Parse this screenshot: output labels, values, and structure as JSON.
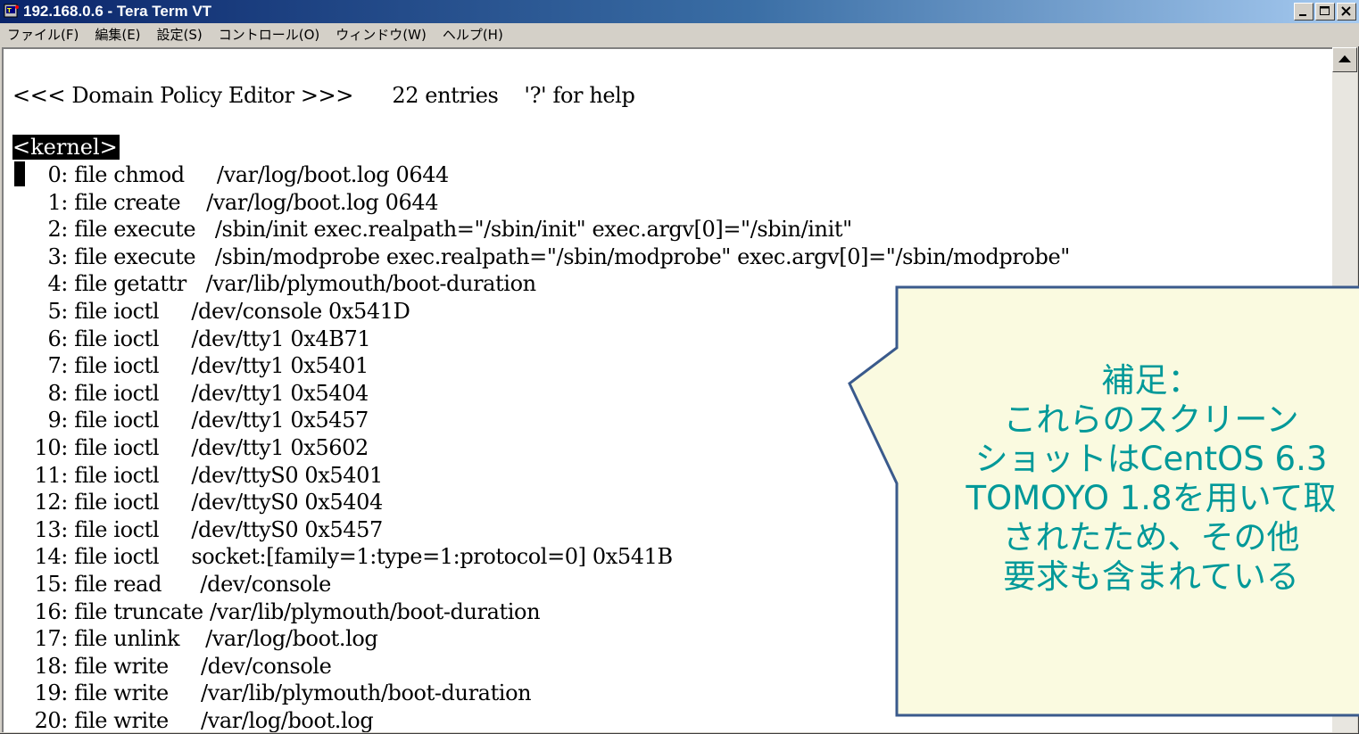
{
  "window": {
    "title": "192.168.0.6 - Tera Term VT",
    "icon": "teraterm-icon",
    "buttons": [
      "minimize",
      "maximize",
      "close"
    ]
  },
  "menubar": {
    "items": [
      "ファイル(F)",
      "編集(E)",
      "設定(S)",
      "コントロール(O)",
      "ウィンドウ(W)",
      "ヘルプ(H)"
    ]
  },
  "terminal": {
    "header": "<<< Domain Policy Editor >>>      22 entries    '?' for help",
    "domain": "<kernel>",
    "entries": [
      {
        "num": "0:",
        "text": "file chmod     /var/log/boot.log 0644"
      },
      {
        "num": "1:",
        "text": "file create    /var/log/boot.log 0644"
      },
      {
        "num": "2:",
        "text": "file execute   /sbin/init exec.realpath=\"/sbin/init\" exec.argv[0]=\"/sbin/init\""
      },
      {
        "num": "3:",
        "text": "file execute   /sbin/modprobe exec.realpath=\"/sbin/modprobe\" exec.argv[0]=\"/sbin/modprobe\""
      },
      {
        "num": "4:",
        "text": "file getattr   /var/lib/plymouth/boot-duration"
      },
      {
        "num": "5:",
        "text": "file ioctl     /dev/console 0x541D"
      },
      {
        "num": "6:",
        "text": "file ioctl     /dev/tty1 0x4B71"
      },
      {
        "num": "7:",
        "text": "file ioctl     /dev/tty1 0x5401"
      },
      {
        "num": "8:",
        "text": "file ioctl     /dev/tty1 0x5404"
      },
      {
        "num": "9:",
        "text": "file ioctl     /dev/tty1 0x5457"
      },
      {
        "num": "10:",
        "text": "file ioctl     /dev/tty1 0x5602"
      },
      {
        "num": "11:",
        "text": "file ioctl     /dev/ttyS0 0x5401"
      },
      {
        "num": "12:",
        "text": "file ioctl     /dev/ttyS0 0x5404"
      },
      {
        "num": "13:",
        "text": "file ioctl     /dev/ttyS0 0x5457"
      },
      {
        "num": "14:",
        "text": "file ioctl     socket:[family=1:type=1:protocol=0] 0x541B"
      },
      {
        "num": "15:",
        "text": "file read      /dev/console"
      },
      {
        "num": "16:",
        "text": "file truncate /var/lib/plymouth/boot-duration"
      },
      {
        "num": "17:",
        "text": "file unlink    /var/log/boot.log"
      },
      {
        "num": "18:",
        "text": "file write     /dev/console"
      },
      {
        "num": "19:",
        "text": "file write     /var/lib/plymouth/boot-duration"
      },
      {
        "num": "20:",
        "text": "file write     /var/log/boot.log"
      }
    ]
  },
  "callout": {
    "text": "補足：\nこれらのスクリーン\nショットはCentOS 6.3\nTOMOYO 1.8を用いて取\nされたため、その他\n要求も含まれている",
    "text_color": "#009999",
    "border_color": "#3a5a8c"
  },
  "colors": {
    "titlebar_start": "#0a246a",
    "titlebar_end": "#a6caf0",
    "terminal_bg": "#ffffff"
  }
}
